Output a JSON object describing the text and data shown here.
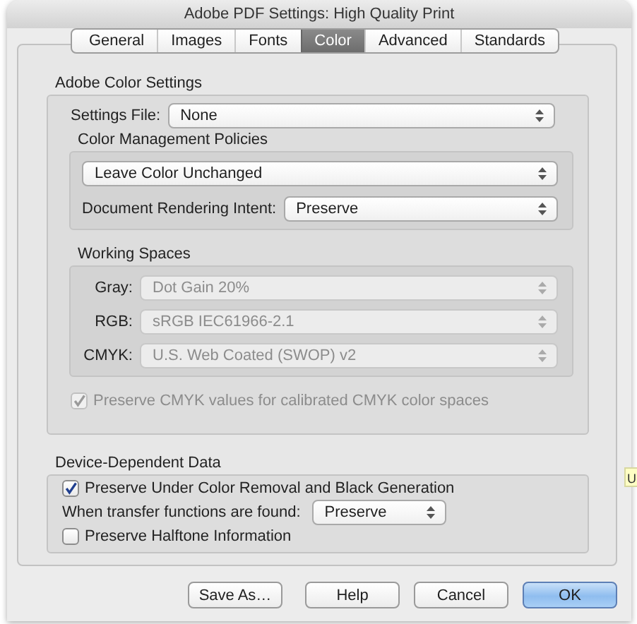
{
  "window": {
    "title": "Adobe PDF Settings: High Quality Print"
  },
  "tabs": [
    {
      "label": "General",
      "selected": false
    },
    {
      "label": "Images",
      "selected": false
    },
    {
      "label": "Fonts",
      "selected": false
    },
    {
      "label": "Color",
      "selected": true
    },
    {
      "label": "Advanced",
      "selected": false
    },
    {
      "label": "Standards",
      "selected": false
    }
  ],
  "color_settings": {
    "heading": "Adobe Color Settings",
    "settings_file": {
      "label": "Settings File:",
      "value": "None",
      "disabled": false
    },
    "policies": {
      "heading": "Color Management Policies",
      "policy": {
        "value": "Leave Color Unchanged",
        "disabled": false
      },
      "rendering_intent": {
        "label": "Document Rendering Intent:",
        "value": "Preserve",
        "disabled": false
      }
    },
    "working_spaces": {
      "heading": "Working Spaces",
      "rows": [
        {
          "label": "Gray:",
          "value": "Dot Gain 20%",
          "disabled": true
        },
        {
          "label": "RGB:",
          "value": "sRGB IEC61966-2.1",
          "disabled": true
        },
        {
          "label": "CMYK:",
          "value": "U.S. Web Coated (SWOP) v2",
          "disabled": true
        }
      ]
    },
    "preserve_cmyk": {
      "label": "Preserve CMYK values for calibrated CMYK color spaces",
      "checked": true,
      "disabled": true
    }
  },
  "device_data": {
    "heading": "Device-Dependent Data",
    "preserve_ucr": {
      "label": "Preserve Under Color Removal and Black Generation",
      "checked": true,
      "disabled": false
    },
    "transfer": {
      "label": "When transfer functions are found:",
      "value": "Preserve",
      "disabled": false
    },
    "preserve_halftone": {
      "label": "Preserve Halftone Information",
      "checked": false,
      "disabled": false
    }
  },
  "buttons": [
    {
      "label": "Save As…",
      "default": false
    },
    {
      "label": "Help",
      "default": false
    },
    {
      "label": "Cancel",
      "default": false
    },
    {
      "label": "OK",
      "default": true
    }
  ],
  "side_tooltip": "U"
}
